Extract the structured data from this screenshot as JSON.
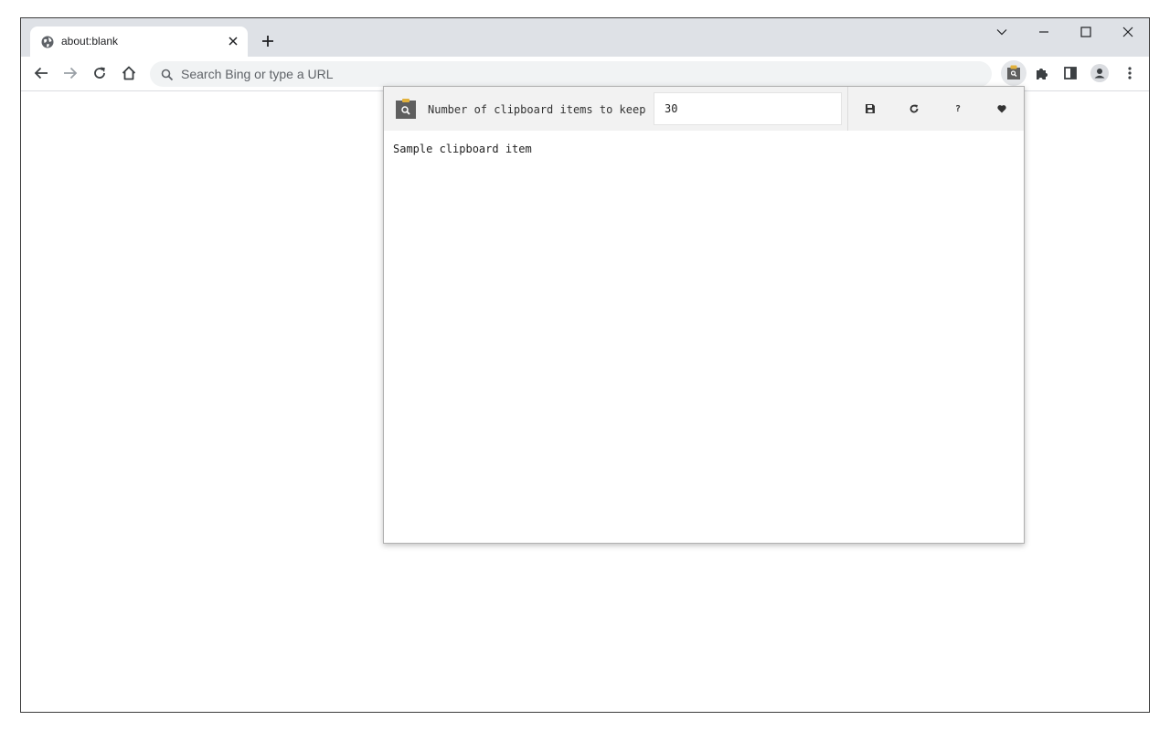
{
  "browser": {
    "tab": {
      "title": "about:blank"
    },
    "omnibox": {
      "placeholder": "Search Bing or type a URL"
    }
  },
  "popup": {
    "label": "Number of clipboard items to keep",
    "items_to_keep": "30",
    "actions": {
      "help_label": "?"
    },
    "clipboard_items": [
      "Sample clipboard item"
    ]
  },
  "icons": [
    "globe-icon",
    "close-icon",
    "plus-icon",
    "chevron-down-icon",
    "minimize-icon",
    "maximize-icon",
    "window-close-icon",
    "back-arrow-icon",
    "forward-arrow-icon",
    "reload-icon",
    "home-icon",
    "search-icon",
    "clipboard-extension-icon",
    "puzzle-icon",
    "side-panel-icon",
    "profile-icon",
    "kebab-menu-icon",
    "save-icon",
    "refresh-icon",
    "heart-icon"
  ],
  "colors": {
    "tabstrip": "#dee1e6",
    "omnibox": "#f1f3f4",
    "popup_header": "#f2f2f2",
    "clipboard_icon": "#5f5f5f",
    "clipboard_clip": "#e2b13c"
  }
}
